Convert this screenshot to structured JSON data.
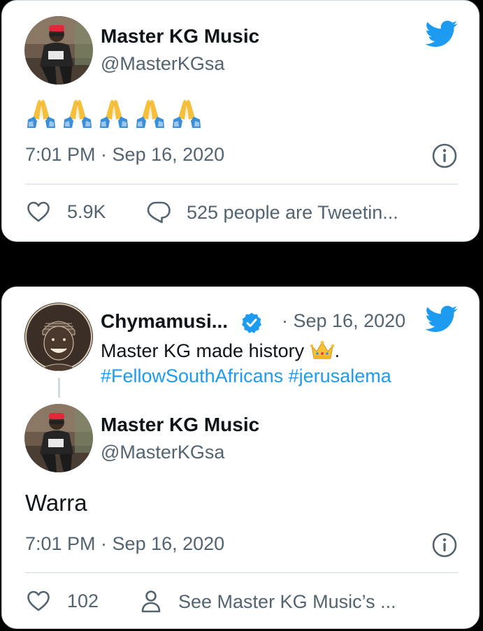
{
  "tweet1": {
    "display_name": "Master KG Music",
    "handle": "@MasterKGsa",
    "emoji": [
      "folded-hands",
      "folded-hands",
      "folded-hands",
      "folded-hands",
      "folded-hands"
    ],
    "timestamp": "7:01 PM · Sep 16, 2020",
    "likes": "5.9K",
    "reply_action": "525 people are Tweetin..."
  },
  "tweet2": {
    "quoted": {
      "display_name": "Chymamusi...",
      "date": "· Sep 16, 2020",
      "text": "Master KG made history",
      "text_suffix": ".",
      "hashtag1": "#FellowSouthAfricans",
      "hashtag2": "#jerusalema"
    },
    "display_name": "Master KG Music",
    "handle": "@MasterKGsa",
    "text": "Warra",
    "timestamp": "7:01 PM · Sep 16, 2020",
    "likes": "102",
    "profile_action": "See Master KG Music’s ..."
  },
  "colors": {
    "twitter_blue": "#1d9bf0",
    "secondary_text": "#536471",
    "primary_text": "#0f1419",
    "border": "#cfd9de",
    "background": "#000000"
  },
  "icons": [
    "twitter-bird-icon",
    "info-icon",
    "heart-icon",
    "speech-bubble-icon",
    "person-icon",
    "verified-badge-icon",
    "crown-icon",
    "folded-hands-emoji"
  ]
}
